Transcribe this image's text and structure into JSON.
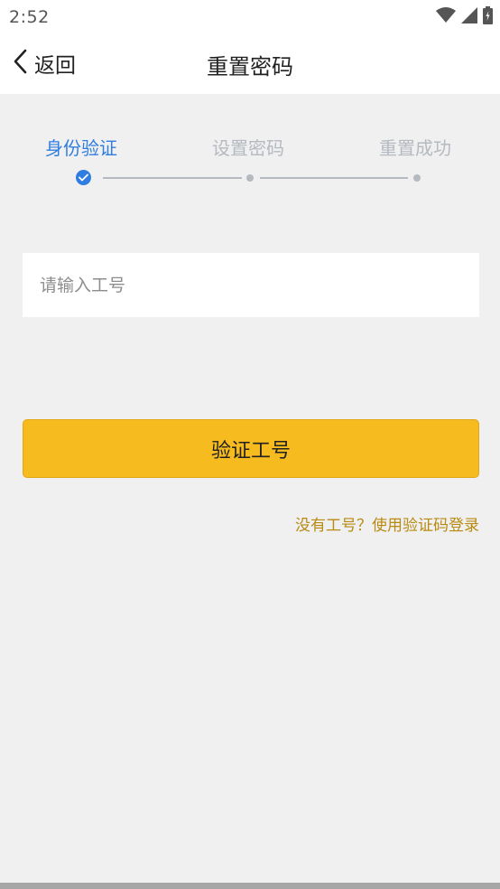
{
  "status_bar": {
    "time": "2:52",
    "icons": [
      "wifi-icon",
      "signal-icon",
      "battery-icon"
    ]
  },
  "nav": {
    "back_label": "返回",
    "title": "重置密码"
  },
  "steps": [
    {
      "label": "身份验证",
      "state": "done"
    },
    {
      "label": "设置密码",
      "state": "pending"
    },
    {
      "label": "重置成功",
      "state": "pending"
    }
  ],
  "form": {
    "employee_id_placeholder": "请输入工号",
    "employee_id_value": "",
    "verify_button": "验证工号",
    "sms_login_link": "没有工号？使用验证码登录"
  },
  "colors": {
    "accent_blue": "#2f7de1",
    "primary_button": "#f5bb1f",
    "link_color": "#b98a12",
    "inactive_step": "#b5b9c0"
  }
}
